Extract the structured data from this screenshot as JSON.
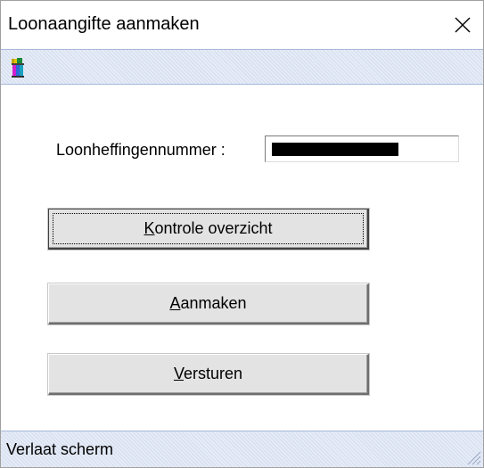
{
  "window": {
    "title": "Loonaangifte aanmaken",
    "close_icon": "close-icon"
  },
  "toolbar": {
    "icon": "info-book-icon"
  },
  "form": {
    "field_label": "Loonheffingennummer :",
    "field_value": "",
    "field_redacted": true
  },
  "buttons": {
    "kontrole": {
      "prefix": "",
      "mnemonic": "K",
      "rest": "ontrole overzicht"
    },
    "aanmaken": {
      "prefix": "",
      "mnemonic": "A",
      "rest": "anmaken"
    },
    "versturen": {
      "prefix": "",
      "mnemonic": "V",
      "rest": "ersturen"
    }
  },
  "statusbar": {
    "text": "Verlaat scherm"
  },
  "colors": {
    "button_face": "#e3e3e3",
    "toolbar_bg": "#e6ecf7",
    "toolbar_border": "#a7b8d8"
  }
}
